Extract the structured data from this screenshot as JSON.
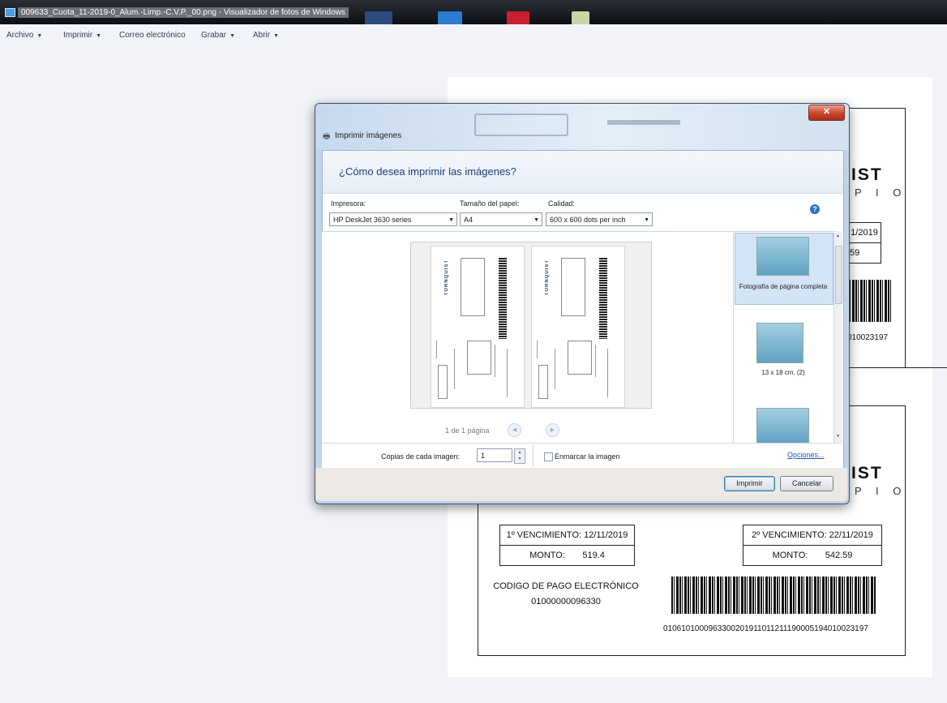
{
  "window": {
    "title": "009633_Cuota_11-2019-0_Alum.-Limp.-C.V.P._00.png - Visualizador de fotos de Windows"
  },
  "menu": {
    "items": [
      "Archivo",
      "Imprimir",
      "Correo electrónico",
      "Grabar",
      "Abrir"
    ]
  },
  "document": {
    "brand_big": "IST",
    "brand_small": "P I O",
    "stub_date": "1/2019",
    "stub_amount": "59",
    "stub_code": "010023197",
    "venc1": {
      "label": "1º VENCIMIENTO:",
      "date": "12/11/2019",
      "monto_label": "MONTO:",
      "monto": "519.4"
    },
    "venc2": {
      "label": "2º VENCIMIENTO:",
      "date": "22/11/2019",
      "monto_label": "MONTO:",
      "monto": "542.59"
    },
    "pago_label": "CODIGO DE PAGO ELECTRÓNICO",
    "pago_code": "01000000096330",
    "barcode_number": "0106101000963300201911011211190005194010023197"
  },
  "dialog": {
    "title": "Imprimir imágenes",
    "heading": "¿Cómo desea imprimir las imágenes?",
    "printer_label": "Impresora:",
    "printer_value": "HP DeskJet 3630 series",
    "paper_label": "Tamaño del papel:",
    "paper_value": "A4",
    "quality_label": "Calidad:",
    "quality_value": "600 x 600 dots per inch",
    "pager_text": "1 de 1 página",
    "thumbnails": [
      {
        "label": "Fotografía de página completa"
      },
      {
        "label": "13 x 18 cm. (2)"
      }
    ],
    "copies_label": "Copias de cada imagen:",
    "copies_value": "1",
    "frame_label": "Enmarcar la imagen",
    "options_link": "Opciones...",
    "print_button": "Imprimir",
    "cancel_button": "Cancelar",
    "preview_brand": "TORNQUIST"
  },
  "colors": {
    "accent": "#1e3f78",
    "titlebar": "#0d0f13",
    "close_button": "#c8442c"
  }
}
